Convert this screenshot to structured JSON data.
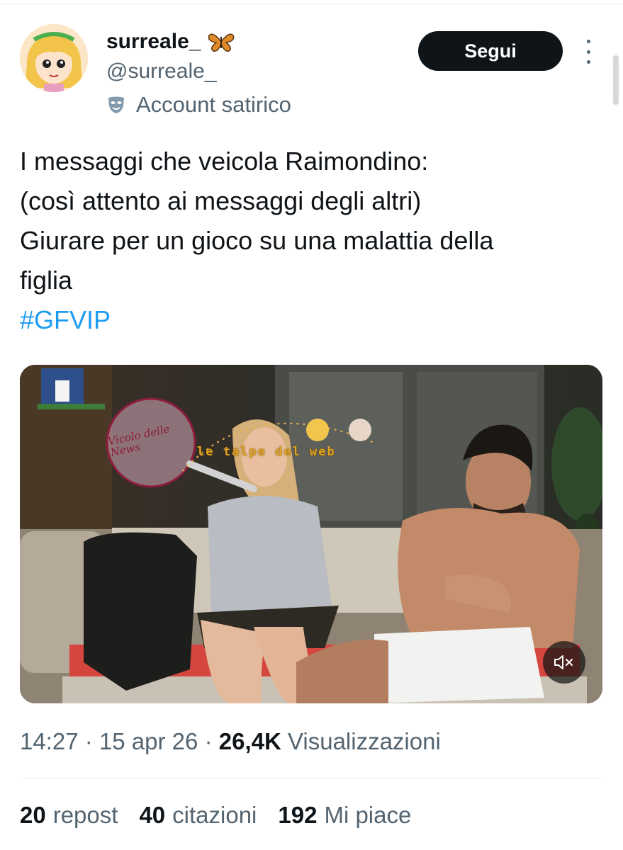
{
  "profile": {
    "display_name": "surreale_",
    "handle": "@surreale_",
    "label": "Account satirico"
  },
  "actions": {
    "follow_label": "Segui"
  },
  "tweet": {
    "lines": [
      "I messaggi che veicola Raimondino:",
      "(così attento ai messaggi degli altri)",
      "Giurare per un gioco su una malattia della",
      "figlia"
    ],
    "hashtag": "#GFVIP"
  },
  "media": {
    "watermark_1": "le talpe del web",
    "watermark_2": "Vicolo delle News"
  },
  "meta": {
    "time": "14:27",
    "date": "15 apr 26",
    "views_count": "26,4K",
    "views_label": "Visualizzazioni"
  },
  "stats": {
    "reposts_count": "20",
    "reposts_label": "repost",
    "quotes_count": "40",
    "quotes_label": "citazioni",
    "likes_count": "192",
    "likes_label": "Mi piace"
  },
  "colors": {
    "link": "#1d9bf0",
    "secondary_text": "#536471",
    "follow_bg": "#0f1419"
  },
  "icons": [
    "butterfly-icon",
    "mask-icon",
    "more-icon",
    "mute-icon"
  ]
}
